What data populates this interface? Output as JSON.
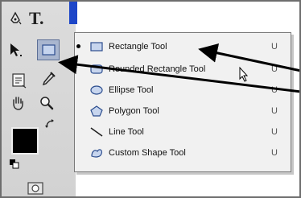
{
  "toolbox": {
    "type_tool_label": "T.",
    "tools": [
      "pen-tool",
      "type-tool",
      "path-selection-tool",
      "shape-tool",
      "notes-tool",
      "eyedropper-tool",
      "hand-tool",
      "zoom-tool",
      "foreground-color",
      "background-color",
      "quick-mask-mode"
    ]
  },
  "shape_menu": {
    "items": [
      {
        "label": "Rectangle Tool",
        "shortcut": "U",
        "icon": "rectangle-icon",
        "selected": true
      },
      {
        "label": "Rounded Rectangle Tool",
        "shortcut": "U",
        "icon": "rounded-rectangle-icon",
        "selected": false
      },
      {
        "label": "Ellipse Tool",
        "shortcut": "U",
        "icon": "ellipse-icon",
        "selected": false
      },
      {
        "label": "Polygon Tool",
        "shortcut": "U",
        "icon": "polygon-icon",
        "selected": false
      },
      {
        "label": "Line Tool",
        "shortcut": "U",
        "icon": "line-icon",
        "selected": false
      },
      {
        "label": "Custom Shape Tool",
        "shortcut": "U",
        "icon": "custom-shape-icon",
        "selected": false
      }
    ]
  },
  "colors": {
    "toolbox_bg": "#d6d6d6",
    "menu_bg": "#f1f1f1",
    "accent_blue": "#1d46c8",
    "foreground_swatch": "#000000",
    "annotation_arrow": "#000000"
  }
}
